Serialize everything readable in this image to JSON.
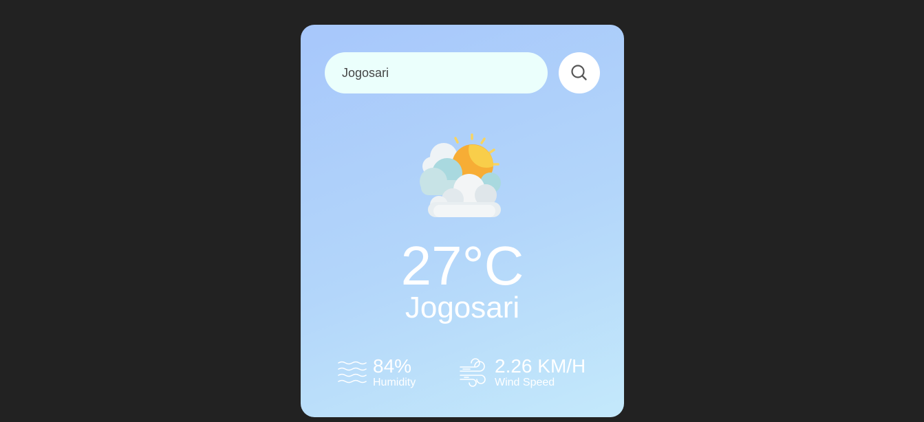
{
  "search": {
    "value": "Jogosari",
    "icon": "search-icon"
  },
  "weather": {
    "icon": "partly-cloudy-icon",
    "temperature": "27°C",
    "city": "Jogosari"
  },
  "details": {
    "humidity": {
      "icon": "humidity-waves-icon",
      "value": "84%",
      "label": "Humidity"
    },
    "wind": {
      "icon": "wind-icon",
      "value": "2.26 KM/H",
      "label": "Wind Speed"
    }
  },
  "colors": {
    "page_background": "#222222",
    "card_gradient_start": "#a7c7fb",
    "card_gradient_end": "#c4e9fb",
    "input_background": "#ebfffc",
    "text": "#ffffff"
  }
}
